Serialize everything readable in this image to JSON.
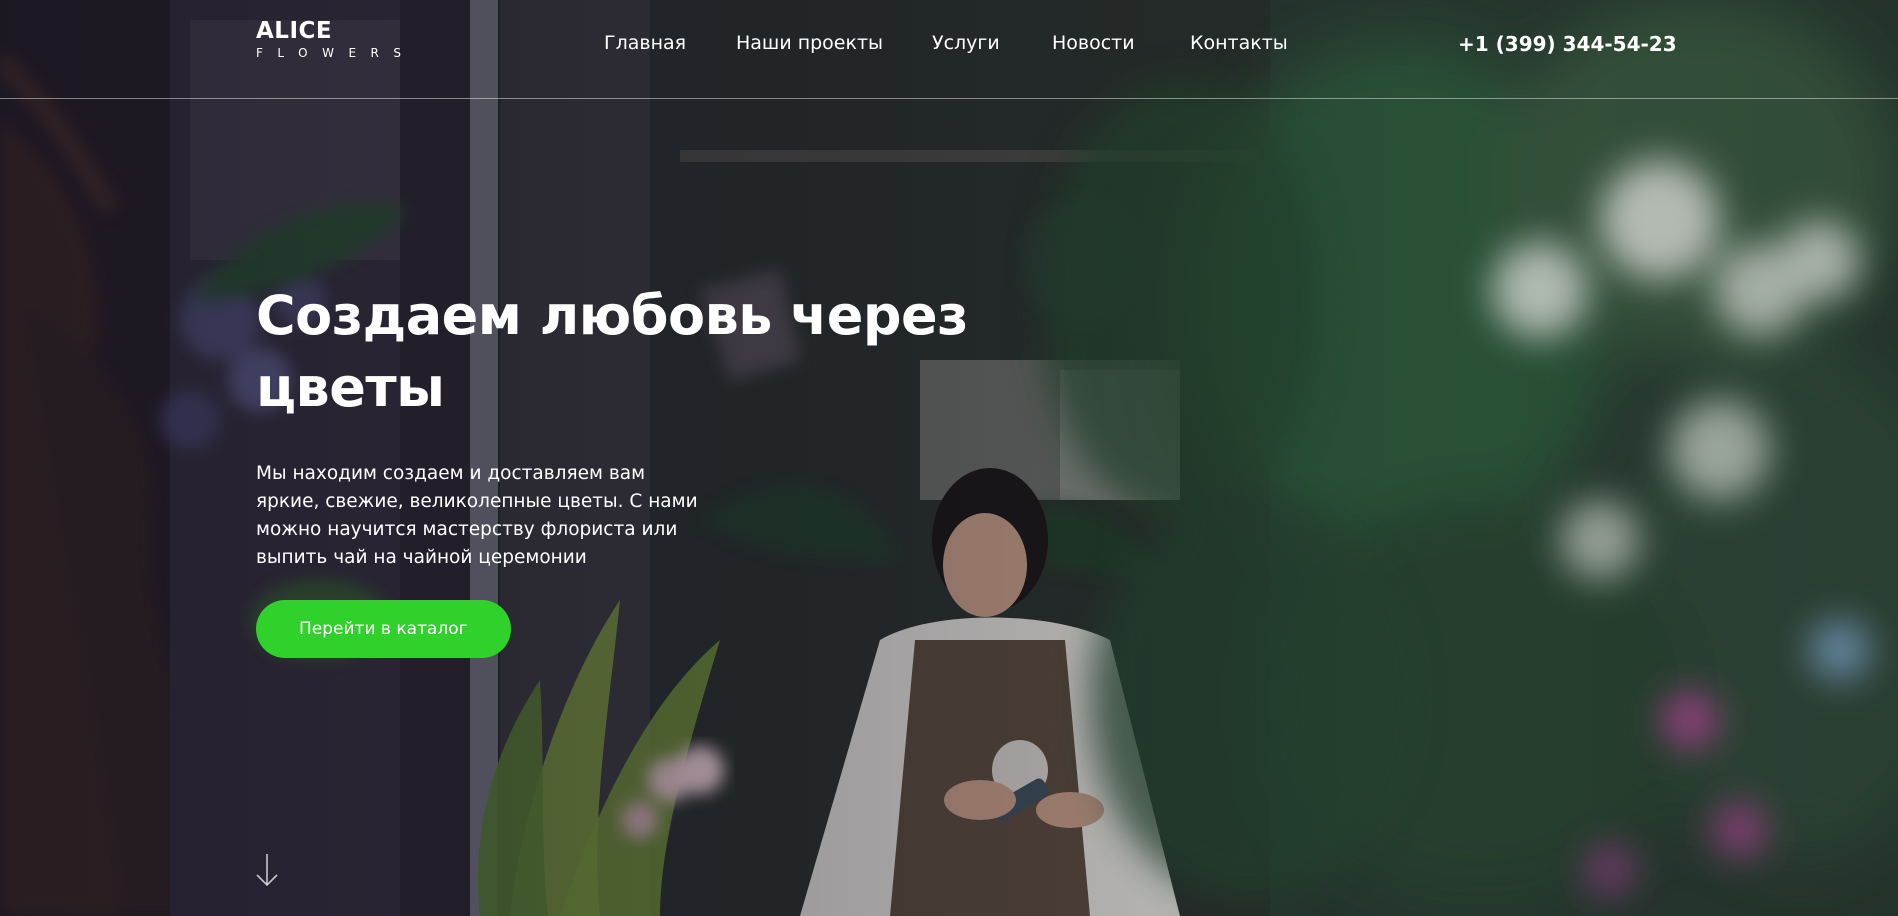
{
  "header": {
    "logo": {
      "main": "ALICE",
      "sub": "FLOWERS"
    },
    "nav": [
      {
        "label": "Главная"
      },
      {
        "label": "Наши проекты"
      },
      {
        "label": "Услуги"
      },
      {
        "label": "Новости"
      },
      {
        "label": "Контакты"
      }
    ],
    "phone": "+1 (399) 344-54-23"
  },
  "hero": {
    "title": "Создаем любовь через цветы",
    "subtitle": "Мы находим создаем и доставляем вам яркие, свежие, великолепные цветы. С нами можно научится мастерству флориста или выпить чай на чайной церемонии",
    "cta_label": "Перейти в каталог",
    "scroll_icon": "arrow-down-icon"
  },
  "colors": {
    "accent": "#2fd12a",
    "text": "#ffffff"
  }
}
